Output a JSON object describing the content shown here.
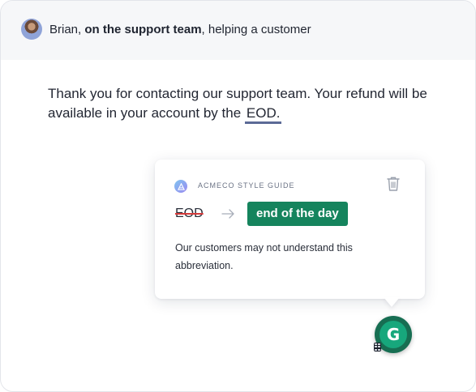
{
  "header": {
    "name": "Brian,",
    "team": "on the support team",
    "context": ", helping a customer"
  },
  "message": {
    "text_before": "Thank you for contacting our support team. Your refund will be available in your account by the",
    "flagged_word": "EOD."
  },
  "suggestion_card": {
    "guide_title": "ACMECO STYLE GUIDE",
    "guide_icon": "style-guide-icon",
    "delete_icon": "trash-icon",
    "original": "EOD",
    "arrow_icon": "arrow-right-icon",
    "replacement": "end of the day",
    "explanation": "Our customers may not understand this abbreviation."
  },
  "assistant_button": {
    "letter": "G",
    "icon": "grammarly-g-icon"
  },
  "colors": {
    "accent_green": "#15845d",
    "flag_underline": "#5b6a96",
    "strike_red": "#d63a3a"
  }
}
